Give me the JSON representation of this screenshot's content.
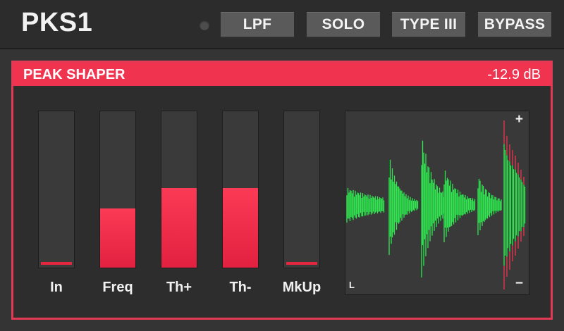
{
  "header": {
    "title": "PKS1",
    "buttons": [
      "LPF",
      "SOLO",
      "TYPE III",
      "BYPASS"
    ]
  },
  "panel": {
    "title": "PEAK SHAPER",
    "value": "-12.9 dB",
    "meters": [
      {
        "label": "In",
        "level": 0.02
      },
      {
        "label": "Freq",
        "level": 0.38
      },
      {
        "label": "Th+",
        "level": 0.51
      },
      {
        "label": "Th-",
        "level": 0.51
      },
      {
        "label": "MkUp",
        "level": 0.02
      }
    ],
    "display": {
      "plus": "+",
      "minus": "−",
      "channel": "L"
    }
  },
  "colors": {
    "accent": "#f0334f",
    "waveform": "#2fe84f",
    "peak": "#f0334f"
  }
}
